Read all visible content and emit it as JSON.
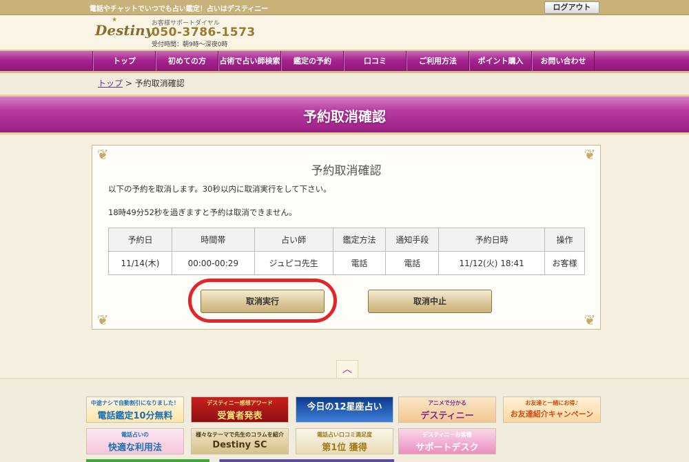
{
  "topbar": {
    "tagline": "電話やチャットでいつでも占い鑑定！占いはデスティニー",
    "logout_label": "ログアウト"
  },
  "header": {
    "logo_text": "Destiny",
    "support_label": "お客様サポートダイヤル",
    "phone": "050-3786-1573",
    "hours": "受付時間：朝9時～深夜0時"
  },
  "nav": {
    "items": [
      {
        "label": "トップ"
      },
      {
        "label": "初めての方"
      },
      {
        "label": "占術で占い師検索"
      },
      {
        "label": "鑑定の予約"
      },
      {
        "label": "口コミ"
      },
      {
        "label": "ご利用方法"
      },
      {
        "label": "ポイント購入"
      },
      {
        "label": "お問い合わせ"
      }
    ]
  },
  "breadcrumb": {
    "home": "トップ",
    "separator": ">",
    "current": "予約取消確認"
  },
  "page_title": "予約取消確認",
  "panel": {
    "heading": "予約取消確認",
    "notice1": "以下の予約を取消します。30秒以内に取消実行をして下さい。",
    "notice2": "18時49分52秒を過ぎますと予約は取消できません。",
    "table": {
      "headers": [
        "予約日",
        "時間帯",
        "占い師",
        "鑑定方法",
        "通知手段",
        "予約日時",
        "操作"
      ],
      "row": [
        "11/14(木)",
        "00:00-00:29",
        "ジュピコ先生",
        "電話",
        "電話",
        "11/12(火) 18:41",
        "お客様"
      ]
    },
    "exec_button": "取消実行",
    "stop_button": "取消中止"
  },
  "highlight_color": "#e0252b",
  "brand_color": "#a6248f",
  "banners": [
    {
      "small": "中途ナシで自動割引になりました！",
      "large": "電話鑑定10分無料"
    },
    {
      "small": "デスティニー感想アワード",
      "large": "受賞者発表"
    },
    {
      "small": "",
      "large": "今日の12星座占い"
    },
    {
      "small": "アニメで分かる",
      "large": "デスティニー"
    },
    {
      "small": "お友達と一緒にお得♪",
      "large": "お友達紹介キャンペーン"
    },
    {
      "small": "電話占いの",
      "large": "快適な利用法"
    },
    {
      "small": "様々なテーマで先生のコラムを紹介",
      "large": "Destiny SC"
    },
    {
      "small": "電話占い口コミ満足度",
      "large": "第1位 獲得"
    },
    {
      "small": "デスティニーお客様",
      "large": "サポートデスク"
    }
  ]
}
